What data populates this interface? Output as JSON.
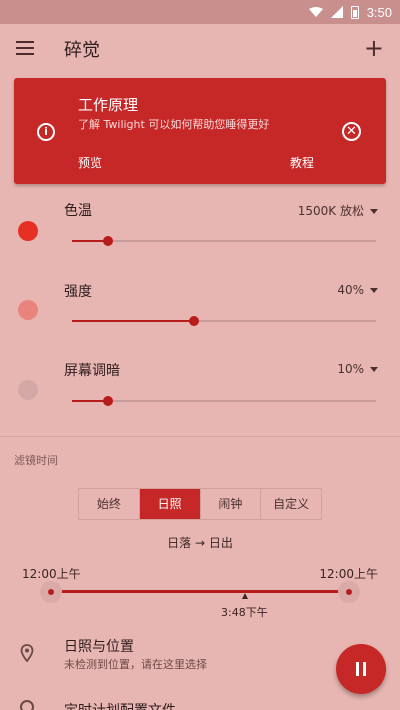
{
  "status": {
    "time": "3:50"
  },
  "appbar": {
    "title": "碎觉"
  },
  "card": {
    "title": "工作原理",
    "subtitle": "了解 Twilight 可以如何帮助您睡得更好",
    "preview_label": "预览",
    "tutorial_label": "教程"
  },
  "settings": [
    {
      "label": "色温",
      "value": "1500K 放松",
      "level": 0.12,
      "dot_color": "#e53023"
    },
    {
      "label": "强度",
      "value": "40%",
      "level": 0.4,
      "dot_color": "#e8847c"
    },
    {
      "label": "屏幕调暗",
      "value": "10%",
      "level": 0.12,
      "dot_color": "#d4a8a6"
    }
  ],
  "schedule": {
    "section_title": "滤镜时间",
    "options": [
      "始终",
      "日照",
      "闹钟",
      "自定义"
    ],
    "selected": 1,
    "range_text": "日落 → 日出",
    "start_time": "12:00上午",
    "end_time": "12:00上午",
    "now_label": "3:48下午",
    "now_fraction": 0.65
  },
  "location": {
    "title": "日照与位置",
    "subtitle": "未检测到位置，请在这里选择"
  },
  "schedule_item": {
    "title": "定时计划配置文件"
  },
  "colors": {
    "accent": "#c62828",
    "background": "#e8b6b2"
  }
}
